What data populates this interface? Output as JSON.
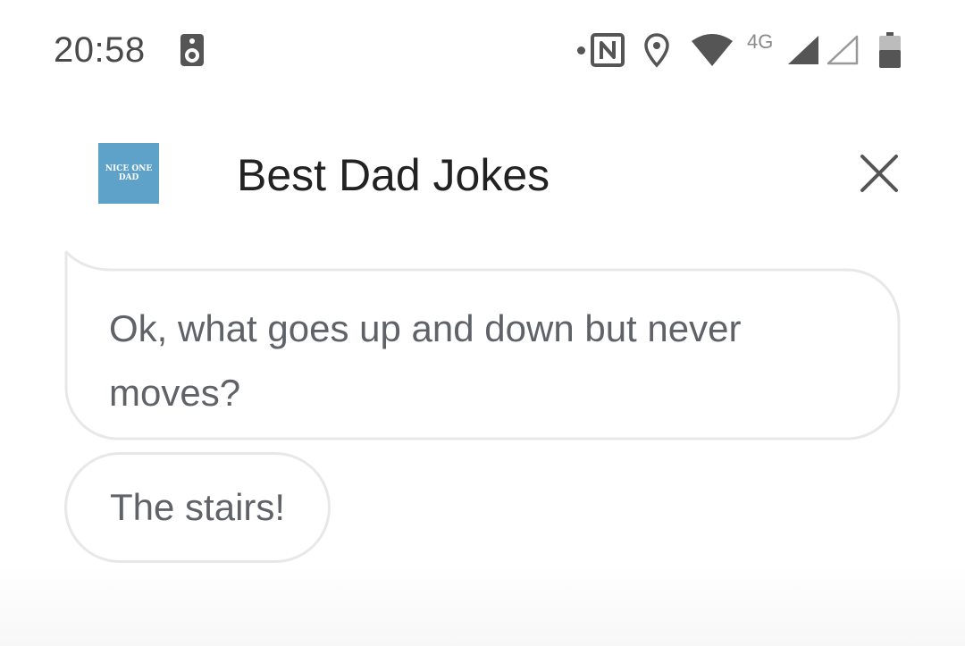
{
  "status_bar": {
    "time": "20:58",
    "network_type": "4G",
    "icons": [
      "speaker-icon",
      "nfc-icon",
      "location-icon",
      "wifi-icon",
      "signal-icon",
      "signal-empty-icon",
      "battery-icon"
    ]
  },
  "header": {
    "logo_line1": "NICE ONE",
    "logo_line2": "DAD",
    "title": "Best Dad Jokes",
    "close_icon": "close-icon"
  },
  "messages": [
    {
      "text": "Ok, what goes up and down but never moves?"
    },
    {
      "text": "The stairs!"
    }
  ],
  "colors": {
    "logo_bg": "#5fa2c9",
    "bubble_border": "#e8e8e8",
    "message_text": "#5f6368",
    "title_text": "#222222"
  }
}
